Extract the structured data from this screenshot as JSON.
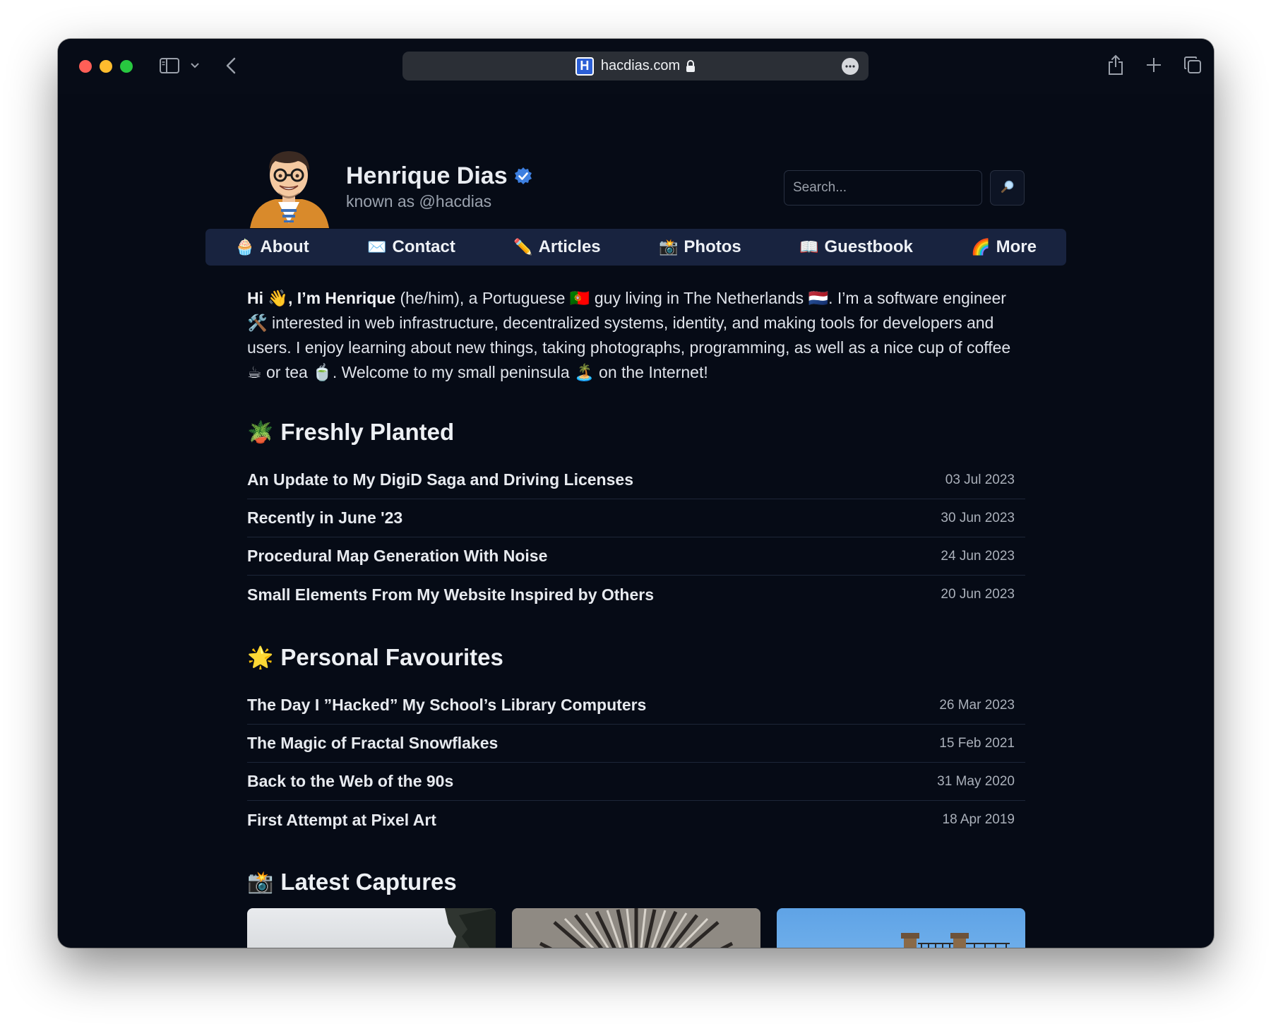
{
  "browser": {
    "url": "hacdias.com",
    "favicon_letter": "H"
  },
  "profile": {
    "name": "Henrique Dias",
    "handle": "known as @hacdias"
  },
  "search": {
    "placeholder": "Search..."
  },
  "nav": [
    {
      "icon": "🧁",
      "label": "About"
    },
    {
      "icon": "✉️",
      "label": "Contact"
    },
    {
      "icon": "✏️",
      "label": "Articles"
    },
    {
      "icon": "📸",
      "label": "Photos"
    },
    {
      "icon": "📖",
      "label": "Guestbook"
    },
    {
      "icon": "🌈",
      "label": "More"
    }
  ],
  "intro": {
    "greeting": "Hi 👋, I’m Henrique",
    "text": " (he/him), a Portuguese 🇵🇹 guy living in The Netherlands 🇳🇱. I’m a software engineer 🛠️ interested in web infrastructure, decentralized systems, identity, and making tools for developers and users. I enjoy learning about new things, taking photographs, programming, as well as a nice cup of coffee ☕ or tea 🍵. Welcome to my small peninsula 🏝️ on the Internet!"
  },
  "freshly_planted": {
    "emoji": "🪴",
    "title": "Freshly Planted",
    "items": [
      {
        "title": "An Update to My DigiD Saga and Driving Licenses",
        "date": "03 Jul 2023"
      },
      {
        "title": "Recently in June '23",
        "date": "30 Jun 2023"
      },
      {
        "title": "Procedural Map Generation With Noise",
        "date": "24 Jun 2023"
      },
      {
        "title": "Small Elements From My Website Inspired by Others",
        "date": "20 Jun 2023"
      }
    ]
  },
  "favourites": {
    "emoji": "🌟",
    "title": "Personal Favourites",
    "items": [
      {
        "title": "The Day I ”Hacked” My School’s Library Computers",
        "date": "26 Mar 2023"
      },
      {
        "title": "The Magic of Fractal Snowflakes",
        "date": "15 Feb 2021"
      },
      {
        "title": "Back to the Web of the 90s",
        "date": "31 May 2020"
      },
      {
        "title": "First Attempt at Pixel Art",
        "date": "18 Apr 2019"
      }
    ]
  },
  "captures": {
    "emoji": "📸",
    "title": "Latest Captures"
  }
}
